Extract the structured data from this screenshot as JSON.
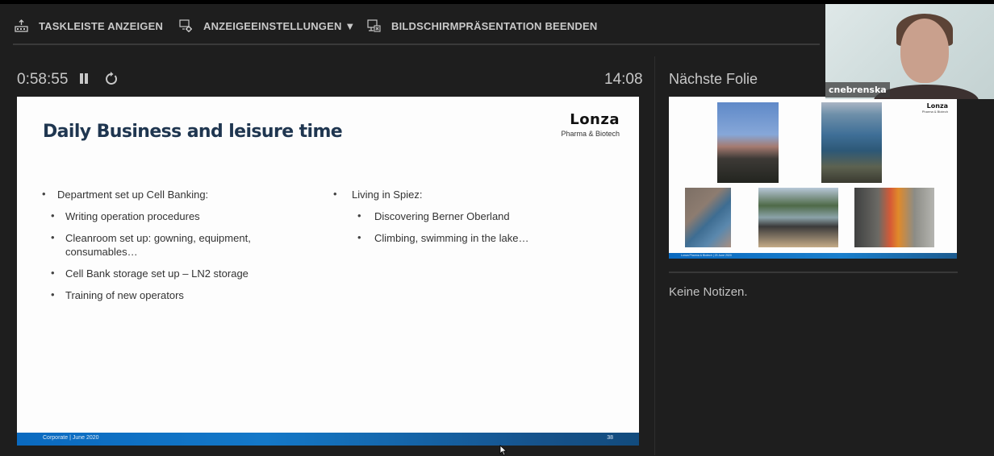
{
  "toolbar": {
    "show_taskbar": "TASKLEISTE ANZEIGEN",
    "display_settings": "ANZEIGEEINSTELLUNGEN ▼",
    "end_show": "BILDSCHIRMPRÄSENTATION BEENDEN"
  },
  "presenter": {
    "elapsed_time": "0:58:55",
    "clock": "14:08",
    "next_slide_label": "Nächste Folie",
    "notes": "Keine Notizen."
  },
  "slide": {
    "title": "Daily Business and leisure time",
    "logo_brand": "Lonza",
    "logo_sub": "Pharma & Biotech",
    "left_column": [
      {
        "level": 1,
        "text": "Department set up Cell Banking:"
      },
      {
        "level": 2,
        "text": "Writing operation procedures"
      },
      {
        "level": 2,
        "text": "Cleanroom set up: gowning, equipment,"
      },
      {
        "level": 3,
        "text": "consumables…"
      },
      {
        "level": 2,
        "text": "Cell Bank storage set up – LN2 storage"
      },
      {
        "level": 2,
        "text": "Training of new operators"
      }
    ],
    "right_column": [
      {
        "level": 1,
        "text": "Living in Spiez:"
      },
      {
        "level": 2,
        "text": "Discovering Berner Oberland"
      },
      {
        "level": 2,
        "text": "Climbing, swimming in the lake…"
      }
    ],
    "footer_text": "Corporate  |  June 2020",
    "page_number": "38",
    "bullet": "•"
  },
  "next_slide": {
    "logo_brand": "Lonza",
    "logo_sub": "Pharma & Biotech",
    "footer_text": "Lonza Pharma & Biotech  |  23 June 2020",
    "photos": [
      "mountain-sunset-photo",
      "lake-water-photo",
      "coastal-cliff-photo",
      "garden-fountain-photo",
      "climbing-group-photo"
    ]
  },
  "video": {
    "participant_name": "cnebrenska"
  },
  "colors": {
    "background": "#1e1e1e",
    "slide_title": "#1f3650",
    "footer_blue": "#0a6ac0"
  }
}
